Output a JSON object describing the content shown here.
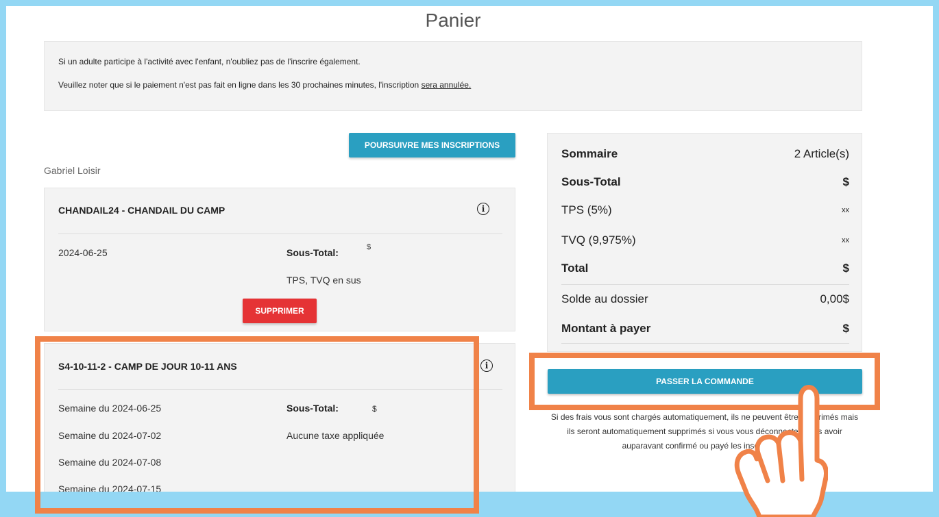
{
  "page": {
    "title": "Panier"
  },
  "notice": {
    "line1": "Si un adulte participe à l'activité avec l'enfant, n'oubliez pas de l'inscrire également.",
    "line2_prefix": "Veuillez noter que si le paiement n'est pas fait en ligne dans les 30 prochaines minutes, l'inscription ",
    "line2_underlined": "sera annulée."
  },
  "actions": {
    "continue_label": "POURSUIVRE MES INSCRIPTIONS",
    "order_label": "PASSER LA COMMANDE"
  },
  "participant": {
    "name": "Gabriel Loisir"
  },
  "cart_items": [
    {
      "title": "CHANDAIL24 - CHANDAIL DU CAMP",
      "date": "2024-06-25",
      "subtotal_label": "Sous-Total:",
      "subtotal_value": "$",
      "tax_note": "TPS, TVQ en sus",
      "delete_label": "SUPPRIMER"
    },
    {
      "title": "S4-10-11-2 - CAMP DE JOUR 10-11 ANS",
      "weeks": [
        "Semaine du 2024-06-25",
        "Semaine du 2024-07-02",
        "Semaine du 2024-07-08",
        "Semaine du 2024-07-15"
      ],
      "subtotal_label": "Sous-Total:",
      "subtotal_value": "$",
      "tax_note": "Aucune taxe appliquée"
    }
  ],
  "summary": {
    "title": "Sommaire",
    "count": "2 Article(s)",
    "subtotal_label": "Sous-Total",
    "subtotal_value": "$",
    "tps_label": "TPS (5%)",
    "tps_value": "xx",
    "tvq_label": "TVQ (9,975%)",
    "tvq_value": "xx",
    "total_label": "Total",
    "total_value": "$",
    "balance_label": "Solde au dossier",
    "balance_value": "0,00$",
    "pay_label": "Montant à payer",
    "pay_value": "$"
  },
  "fee_note": "Si des frais vous sont chargés automatiquement, ils ne peuvent être supprimés mais ils seront automatiquement supprimés si vous vous déconnectez sans avoir auparavant confirmé ou payé les inscriptions.",
  "icons": {
    "info": "info-circle-icon",
    "hand": "pointing-hand-icon"
  },
  "colors": {
    "primary_button": "#2a9fc1",
    "delete_button": "#e53335",
    "highlight": "#f08248",
    "frame": "#93d7f4"
  }
}
